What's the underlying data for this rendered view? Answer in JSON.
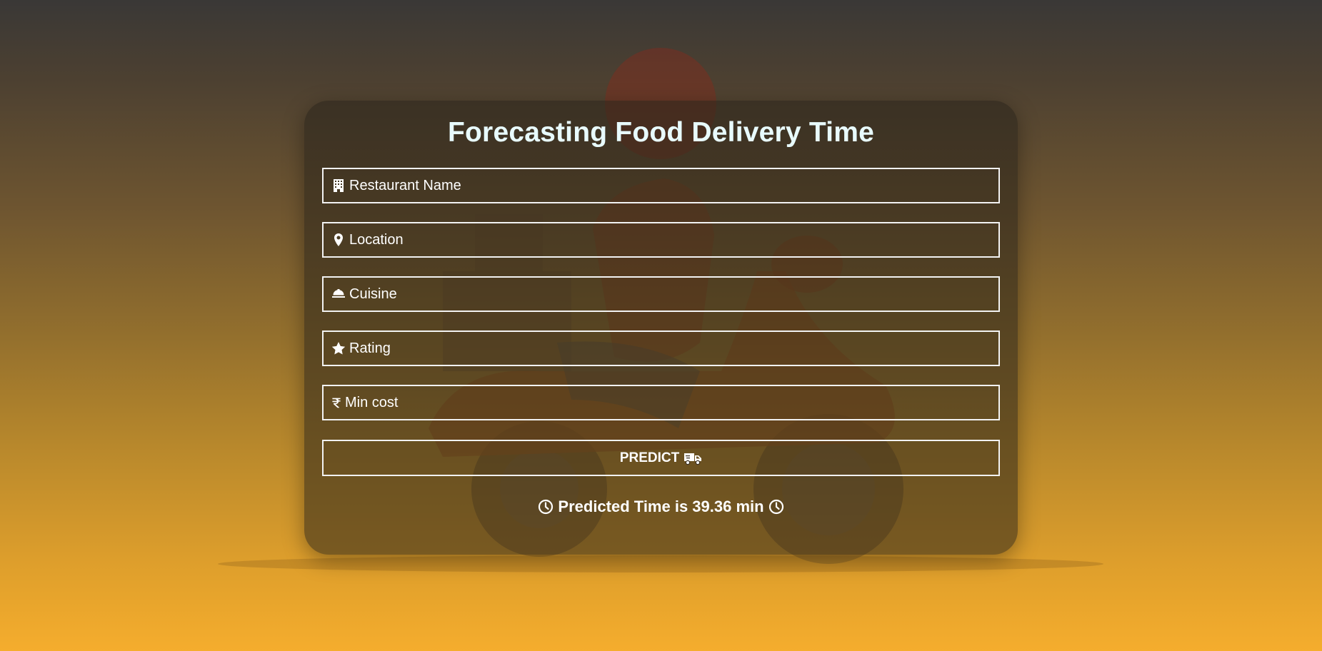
{
  "page": {
    "title": "Forecasting Food Delivery Time",
    "accent_bg_top": "#3a3836",
    "accent_bg_bottom": "#f5ad2d"
  },
  "form": {
    "fields": [
      {
        "icon": "building-icon",
        "placeholder": "Restaurant Name",
        "value": ""
      },
      {
        "icon": "location-pin-icon",
        "placeholder": "Location",
        "value": ""
      },
      {
        "icon": "service-bell-icon",
        "placeholder": "Cuisine",
        "value": ""
      },
      {
        "icon": "star-icon",
        "placeholder": "Rating",
        "value": ""
      },
      {
        "icon": "rupee-icon",
        "placeholder": "Min cost",
        "value": ""
      }
    ],
    "predict_label": "PREDICT",
    "predict_icon": "delivery-truck-icon"
  },
  "result": {
    "text": "Predicted Time is 39.36 min",
    "icon": "clock-icon"
  }
}
